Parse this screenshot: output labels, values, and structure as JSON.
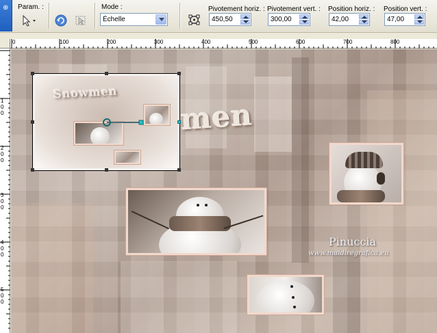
{
  "toolbar": {
    "param_label": "Param. :",
    "mode_label": "Mode :",
    "mode_value": "Échelle",
    "pivot_h_label": "Pivotement horiz. :",
    "pivot_h_value": "450,50",
    "pivot_v_label": "Pivotement vert. :",
    "pivot_v_value": "300,00",
    "pos_h_label": "Position horiz. :",
    "pos_h_value": "42,00",
    "pos_v_label": "Position vert. :",
    "pos_v_value": "47,00"
  },
  "ruler": {
    "h_labels": [
      "0",
      "100",
      "200",
      "300",
      "400",
      "500",
      "600",
      "700",
      "800"
    ],
    "v_labels": [
      "1\n0\n0",
      "2\n0\n0",
      "3\n0\n0",
      "4\n0\n0",
      "5\n0\n0"
    ]
  },
  "canvas": {
    "title_big": "men",
    "title_small": "Snowmen",
    "signature_name": "Pinuccia",
    "signature_url": "www.maidiregrafica.eu"
  },
  "colors": {
    "accent": "#2060c0",
    "frame": "#f2d9cc",
    "handle": "#25c1c9"
  }
}
